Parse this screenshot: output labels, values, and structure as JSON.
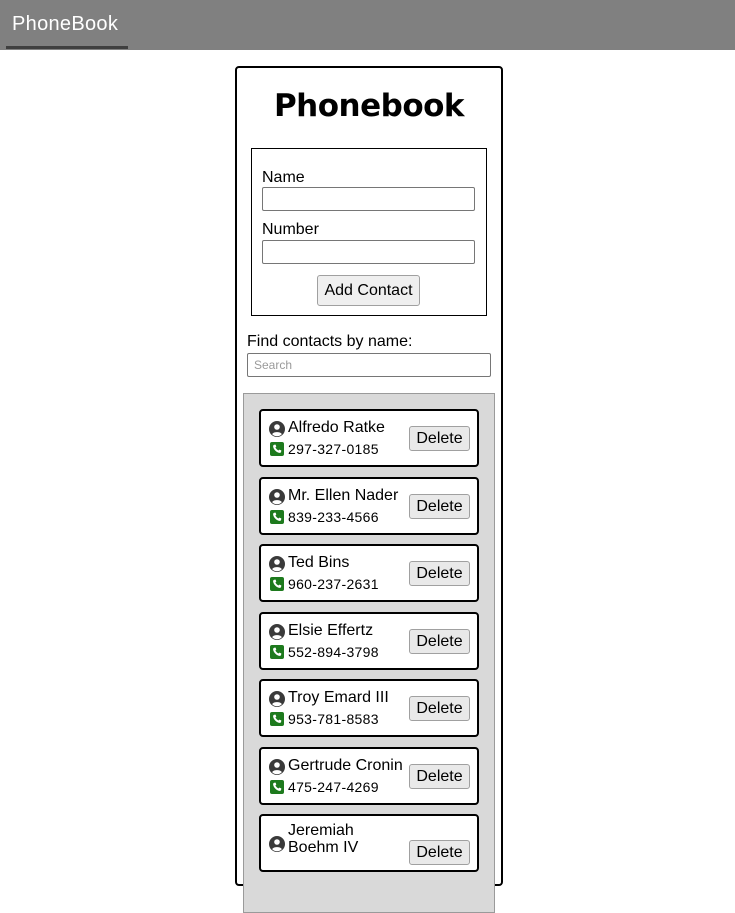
{
  "appbar": {
    "tab_label": "PhoneBook"
  },
  "page": {
    "title": "Phonebook"
  },
  "form": {
    "name_label": "Name",
    "name_value": "",
    "number_label": "Number",
    "number_value": "",
    "submit_label": "Add Contact"
  },
  "filter": {
    "label": "Find contacts by name:",
    "placeholder": "Search",
    "value": ""
  },
  "contacts": [
    {
      "name": "Alfredo Ratke",
      "number": "297-327-0185",
      "delete_label": "Delete"
    },
    {
      "name": "Mr. Ellen Nader",
      "number": "839-233-4566",
      "delete_label": "Delete"
    },
    {
      "name": "Ted Bins",
      "number": "960-237-2631",
      "delete_label": "Delete"
    },
    {
      "name": "Elsie Effertz",
      "number": "552-894-3798",
      "delete_label": "Delete"
    },
    {
      "name": "Troy Emard III",
      "number": "953-781-8583",
      "delete_label": "Delete"
    },
    {
      "name": "Gertrude Cronin",
      "number": "475-247-4269",
      "delete_label": "Delete"
    },
    {
      "name": "Jeremiah Boehm IV",
      "number": "",
      "delete_label": "Delete"
    }
  ],
  "icons": {
    "person": "person-circle-icon",
    "phone": "phone-square-icon"
  },
  "colors": {
    "appbar": "#808080",
    "list_background": "#d9d9d9",
    "phone_icon": "#1d7a1d",
    "person_icon": "#3a3a3a"
  }
}
